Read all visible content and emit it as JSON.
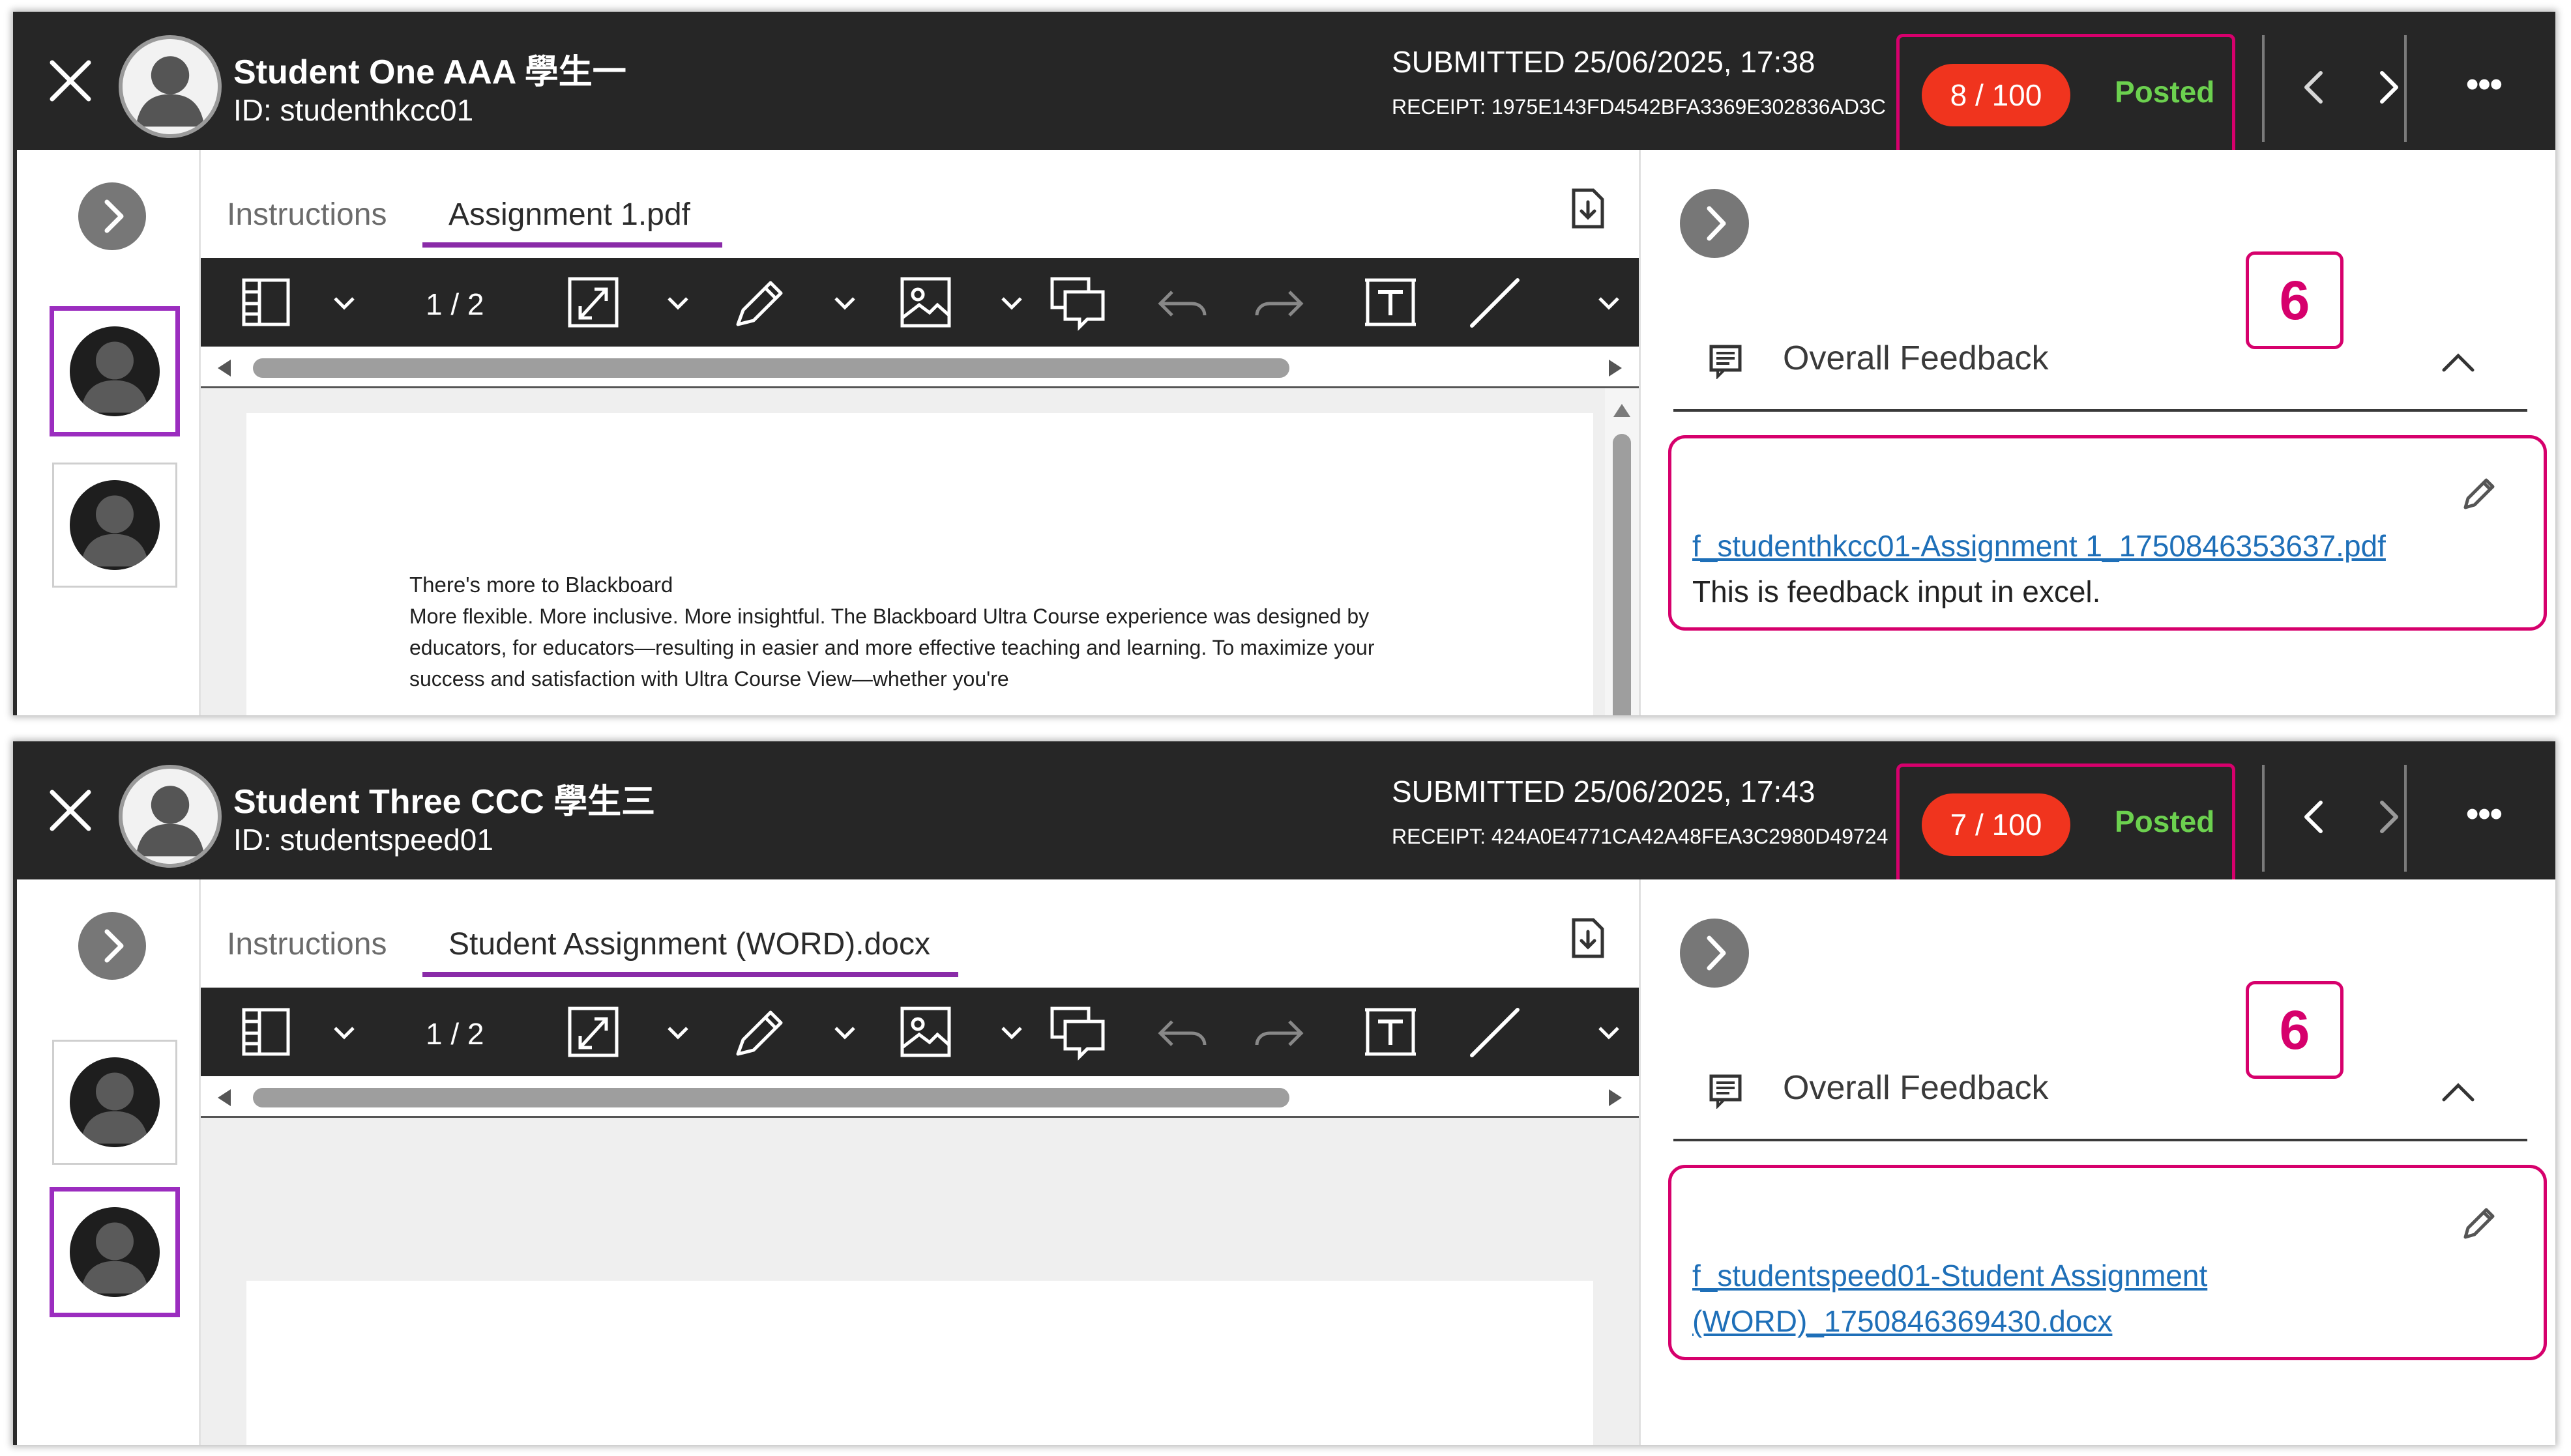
{
  "colors": {
    "header_bg": "#262626",
    "grade_pill": "#f0341e",
    "posted": "#6cd14f",
    "highlight": "#d6006c",
    "selected_thumb": "#9b2dbf",
    "link": "#1e6fb8"
  },
  "panels": [
    {
      "student": {
        "name": "Student One AAA 學生一",
        "id": "ID: studenthkcc01"
      },
      "submitted": "SUBMITTED 25/06/2025, 17:38",
      "receipt": "RECEIPT: 1975E143FD4542BFA3369E302836AD3C",
      "grade": "8 / 100",
      "status": "Posted",
      "more": "•••",
      "tabs": {
        "instructions": "Instructions",
        "file": "Assignment 1.pdf"
      },
      "page_counter": "1 / 2",
      "doc": {
        "heading": "There's more to Blackboard",
        "body": "More flexible. More inclusive. More insightful. The Blackboard Ultra Course experience was designed by educators, for educators—resulting in easier and more effective teaching and learning. To maximize your success and satisfaction with Ultra Course View—whether you're"
      },
      "feedback": {
        "step": "6",
        "title": "Overall Feedback",
        "link": "f_studenthkcc01-Assignment 1_1750846353637.pdf",
        "text": "This is feedback input in excel."
      },
      "selected_thumb": 0
    },
    {
      "student": {
        "name": "Student Three CCC 學生三",
        "id": "ID: studentspeed01"
      },
      "submitted": "SUBMITTED 25/06/2025, 17:43",
      "receipt": "RECEIPT: 424A0E4771CA42A48FEA3C2980D49724",
      "grade": "7 / 100",
      "status": "Posted",
      "more": "•••",
      "tabs": {
        "instructions": "Instructions",
        "file": "Student Assignment (WORD).docx"
      },
      "page_counter": "1 / 2",
      "feedback": {
        "step": "6",
        "title": "Overall Feedback",
        "link": "f_studentspeed01-Student Assignment (WORD)_1750846369430.docx",
        "text": ""
      },
      "selected_thumb": 1
    }
  ]
}
